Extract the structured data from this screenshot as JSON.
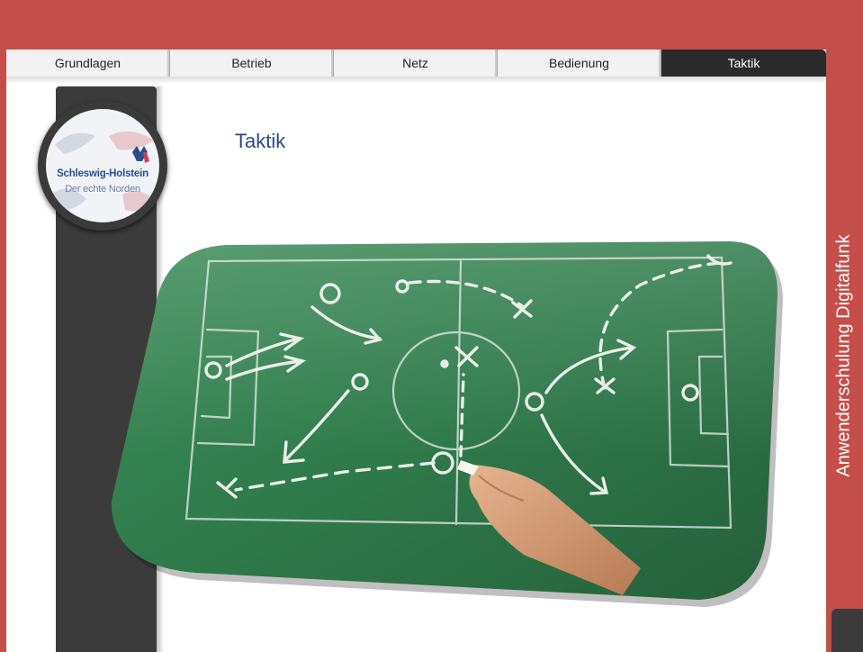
{
  "nav": {
    "tabs": [
      {
        "label": "Grundlagen",
        "active": false
      },
      {
        "label": "Betrieb",
        "active": false
      },
      {
        "label": "Netz",
        "active": false
      },
      {
        "label": "Bedienung",
        "active": false
      },
      {
        "label": "Taktik",
        "active": true
      }
    ]
  },
  "page": {
    "title": "Taktik"
  },
  "logo": {
    "line1": "Schleswig-Holstein",
    "line2": "Der echte Norden"
  },
  "sidebar": {
    "label": "Anwenderschulung Digitalfunk"
  },
  "colors": {
    "accent": "#c44e4a",
    "dark": "#3b3b3b",
    "title": "#294b82",
    "chalkboard": "#2f7a4b"
  }
}
